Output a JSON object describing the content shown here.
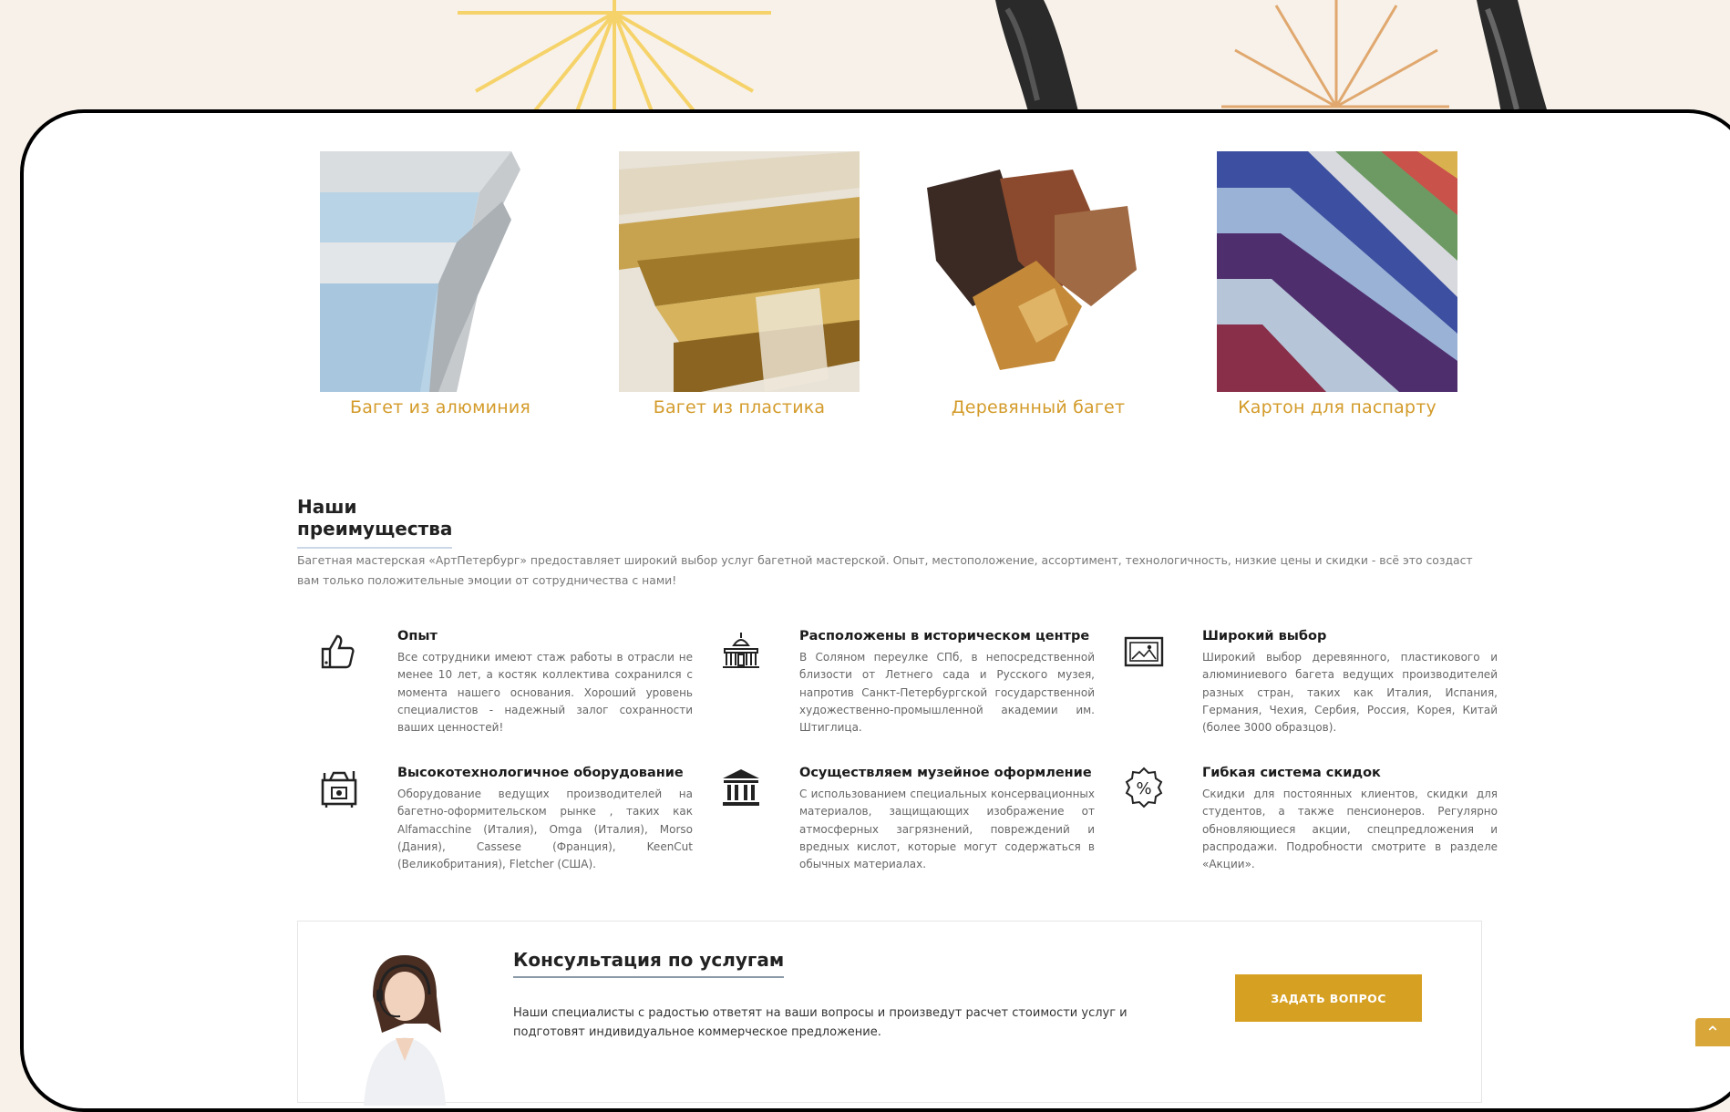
{
  "products": [
    {
      "label": "Багет из алюминия",
      "icon": "aluminium-frame-image"
    },
    {
      "label": "Багет из пластика",
      "icon": "plastic-frame-image"
    },
    {
      "label": "Деревянный багет",
      "icon": "wooden-frame-image"
    },
    {
      "label": "Картон для паспарту",
      "icon": "passepartout-cardboard-image"
    }
  ],
  "advantages": {
    "title": "Наши преимущества",
    "intro": "Багетная мастерская «АртПетербург» предоставляет широкий выбор услуг багетной мастерской. Опыт, местоположение, ассортимент, технологичность, низкие цены и скидки - всё это создаст вам только положительные эмоции от сотрудничества с нами!",
    "items": [
      {
        "title": "Опыт",
        "icon": "thumbs-up-icon",
        "text": "Все сотрудники имеют стаж работы в отрасли не менее 10 лет, а костяк коллектива сохранился с момента нашего основания. Хороший уровень специалистов - надежный залог сохранности ваших ценностей!"
      },
      {
        "title": "Расположены в историческом центре",
        "icon": "historic-building-icon",
        "text": "В Соляном переулке СПб, в непосредственной близости от Летнего сада и Русского музея, напротив Санкт-Петербургской государственной художественно-промышленной академии им. Штиглица."
      },
      {
        "title": "Широкий выбор",
        "icon": "picture-frame-icon",
        "text": "Широкий выбор деревянного, пластикового и алюминиевого багета ведущих производителей разных стран, таких как Италия, Испания, Германия, Чехия, Сербия, Россия, Корея, Китай (более 3000 образцов)."
      },
      {
        "title": "Высокотехнологичное оборудование",
        "icon": "machine-icon",
        "text": "Оборудование ведущих производителей на багетно-оформительском рынке , таких как Alfamacchine (Италия), Omga (Италия), Morso (Дания), Cassese (Франция), KeenCut (Великобритания), Fletcher (США)."
      },
      {
        "title": "Осуществляем музейное оформление",
        "icon": "museum-icon",
        "text": "С использованием специальных консервационных материалов, защищающих изображение от атмосферных загрязнений, повреждений и вредных кислот, которые могут содержаться в обычных материалах."
      },
      {
        "title": "Гибкая система скидок",
        "icon": "percent-badge-icon",
        "text": "Скидки для постоянных клиентов, скидки для студентов, а также пенсионеров. Регулярно обновляющиеся акции, спецпредложения и распродажи. Подробности смотрите в разделе «Акции»."
      }
    ]
  },
  "consultation": {
    "title": "Консультация по услугам",
    "text": "Наши специалисты с радостью ответят на ваши вопросы и произведут расчет стоимости услуг и подготовят индивидуальное коммерческое предложение.",
    "button": "ЗАДАТЬ ВОПРОС"
  },
  "colors": {
    "accent": "#d6a022",
    "background": "#f7f1ea",
    "label": "#d39b2a"
  }
}
